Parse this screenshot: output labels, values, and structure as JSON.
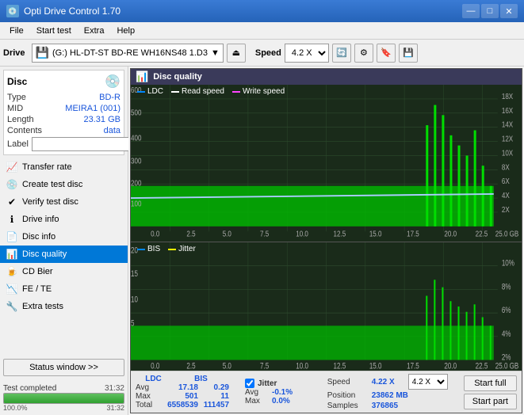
{
  "app": {
    "title": "Opti Drive Control 1.70",
    "icon": "💿"
  },
  "titlebar": {
    "minimize": "—",
    "maximize": "□",
    "close": "✕"
  },
  "menu": {
    "items": [
      "File",
      "Start test",
      "Extra",
      "Help"
    ]
  },
  "toolbar": {
    "drive_label": "Drive",
    "drive_value": "(G:) HL-DT-ST BD-RE WH16NS48 1.D3",
    "speed_label": "Speed",
    "speed_value": "4.2 X"
  },
  "disc": {
    "title": "Disc",
    "type_label": "Type",
    "type_value": "BD-R",
    "mid_label": "MID",
    "mid_value": "MEIRA1 (001)",
    "length_label": "Length",
    "length_value": "23.31 GB",
    "contents_label": "Contents",
    "contents_value": "data",
    "label_label": "Label"
  },
  "nav": {
    "items": [
      {
        "id": "transfer-rate",
        "label": "Transfer rate",
        "icon": "📈"
      },
      {
        "id": "create-test-disc",
        "label": "Create test disc",
        "icon": "💿"
      },
      {
        "id": "verify-test-disc",
        "label": "Verify test disc",
        "icon": "✔"
      },
      {
        "id": "drive-info",
        "label": "Drive info",
        "icon": "ℹ"
      },
      {
        "id": "disc-info",
        "label": "Disc info",
        "icon": "📄"
      },
      {
        "id": "disc-quality",
        "label": "Disc quality",
        "icon": "📊",
        "active": true
      },
      {
        "id": "cd-bier",
        "label": "CD Bier",
        "icon": "🍺"
      },
      {
        "id": "fe-te",
        "label": "FE / TE",
        "icon": "📉"
      },
      {
        "id": "extra-tests",
        "label": "Extra tests",
        "icon": "🔧"
      }
    ]
  },
  "status_btn": "Status window >>",
  "progress": {
    "value": 100,
    "text": "Test completed",
    "time": "31:32"
  },
  "dq_panel": {
    "title": "Disc quality",
    "legend": {
      "ldc": "LDC",
      "read_speed": "Read speed",
      "write_speed": "Write speed"
    },
    "legend2": {
      "bis": "BIS",
      "jitter": "Jitter"
    }
  },
  "stats": {
    "columns": [
      "LDC",
      "BIS"
    ],
    "avg_label": "Avg",
    "avg_ldc": "17.18",
    "avg_bis": "0.29",
    "max_label": "Max",
    "max_ldc": "501",
    "max_bis": "11",
    "total_label": "Total",
    "total_ldc": "6558539",
    "total_bis": "111457",
    "jitter_label": "Jitter",
    "jitter_avg": "-0.1%",
    "jitter_max": "0.0%",
    "speed_label": "Speed",
    "speed_value": "4.22 X",
    "speed_select": "4.2 X",
    "position_label": "Position",
    "position_value": "23862 MB",
    "samples_label": "Samples",
    "samples_value": "376865",
    "start_full_btn": "Start full",
    "start_part_btn": "Start part"
  },
  "colors": {
    "ldc_line": "#00aaff",
    "read_speed": "#ffffff",
    "write_speed": "#ff00ff",
    "bis_line": "#00ffaa",
    "jitter_line": "#ffff00",
    "grid": "#2a4a2a",
    "bar_green": "#00dd00",
    "bar_blue": "#0044ff",
    "accent_blue": "#1a56db"
  }
}
